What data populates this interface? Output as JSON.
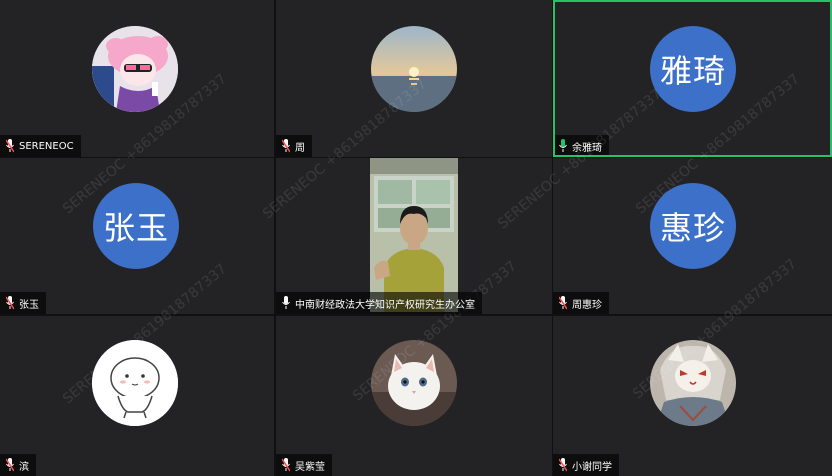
{
  "watermark_text": "SERENEOC +8619818787337",
  "accent_active": "#23c36a",
  "text_avatar_color": "#3c70c9",
  "participants": [
    {
      "name": "SERENEOC",
      "avatar": "pink-hair-anime-avatar",
      "mic": "muted"
    },
    {
      "name": "周",
      "avatar": "sunset-sea-avatar",
      "mic": "muted"
    },
    {
      "name": "余雅琦",
      "avatar_text": "雅琦",
      "mic": "active",
      "active_speaker": true
    },
    {
      "name": "张玉",
      "avatar_text": "张玉",
      "mic": "muted"
    },
    {
      "name": "中南财经政法大学知识产权研究生办公室",
      "avatar": "camera-video",
      "mic": "unmuted"
    },
    {
      "name": "周惠珍",
      "avatar_text": "惠珍",
      "mic": "muted"
    },
    {
      "name": "滨",
      "avatar": "white-cartoon-avatar",
      "mic": "muted"
    },
    {
      "name": "吴紫莹",
      "avatar": "white-cat-avatar",
      "mic": "muted"
    },
    {
      "name": "小谢同学",
      "avatar": "fox-mask-anime-avatar",
      "mic": "muted"
    }
  ]
}
